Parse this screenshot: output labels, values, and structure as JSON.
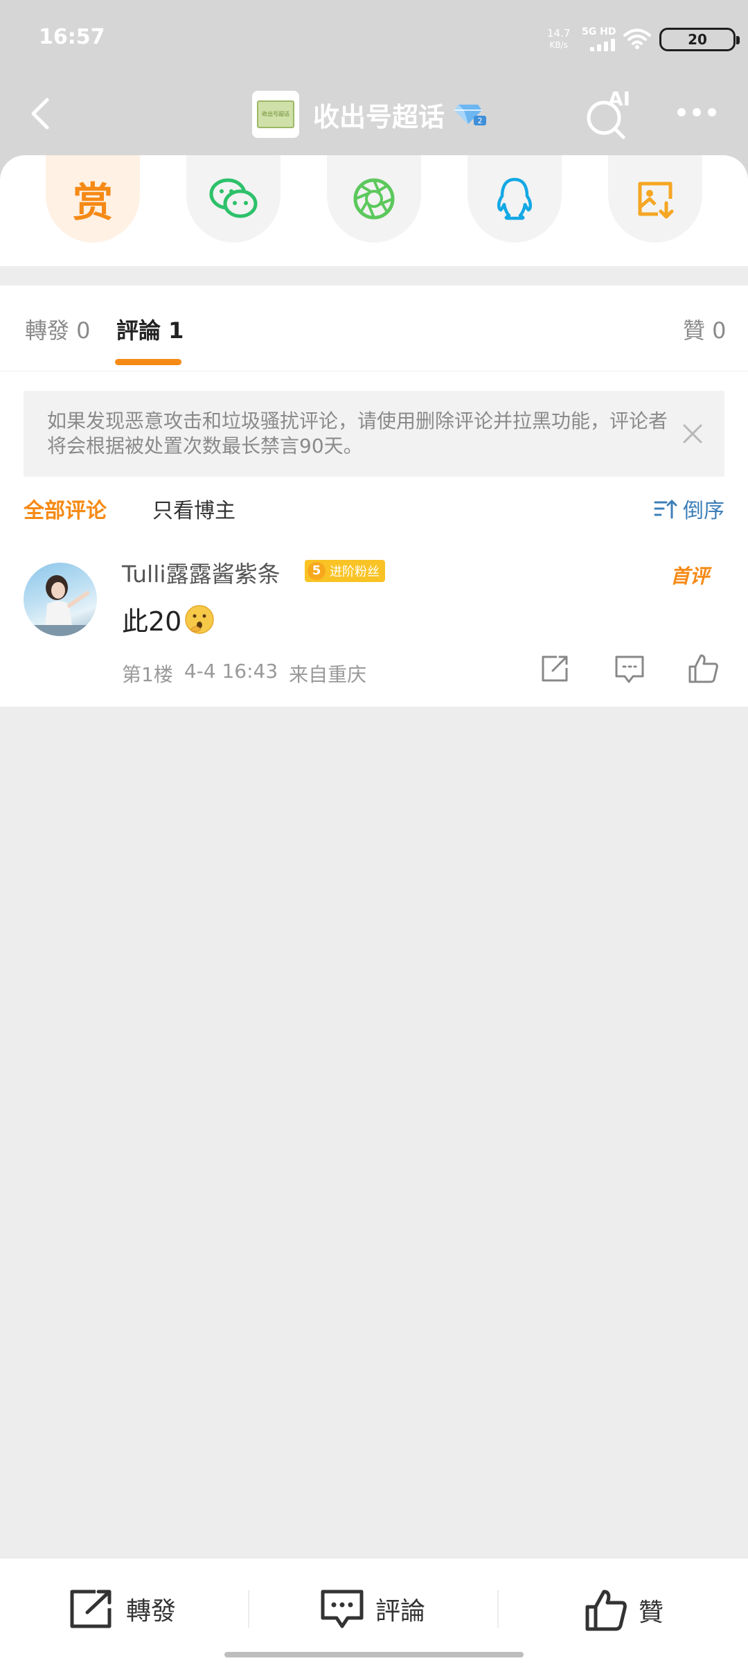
{
  "status_bar": {
    "time": "16:57",
    "net_speed_value": "14.7",
    "net_speed_unit": "KB/s",
    "signal_label": "5G HD",
    "battery": "20"
  },
  "nav": {
    "title": "收出号超话",
    "logo_text": "收出号超话",
    "ai_label": "AI"
  },
  "share": {
    "reward_label": "赏",
    "items": [
      "reward-icon",
      "wechat-icon",
      "moments-icon",
      "qq-icon",
      "save-image-icon"
    ]
  },
  "tabs": {
    "repost": "轉發 0",
    "comments": "評論 1",
    "likes": "贊 0"
  },
  "notice": {
    "text": "如果发现恶意攻击和垃圾骚扰评论，请使用删除评论并拉黑功能，评论者将会根据被处置次数最长禁言90天。"
  },
  "filter": {
    "all": "全部评论",
    "blogger_only": "只看博主",
    "sort": "倒序"
  },
  "comment": {
    "username": "Tulli露露酱紫条",
    "fan_level": "5",
    "fan_label": "进阶粉丝",
    "first_tag": "首评",
    "text": "此20",
    "floor": "第1楼",
    "time": "4-4 16:43",
    "location": "来自重庆"
  },
  "bottom_bar": {
    "repost": "轉發",
    "comment": "評論",
    "like": "贊"
  },
  "colors": {
    "accent": "#f58a16",
    "link": "#3d7fb8",
    "wechat": "#2dc16a",
    "qq": "#13a8e4"
  }
}
